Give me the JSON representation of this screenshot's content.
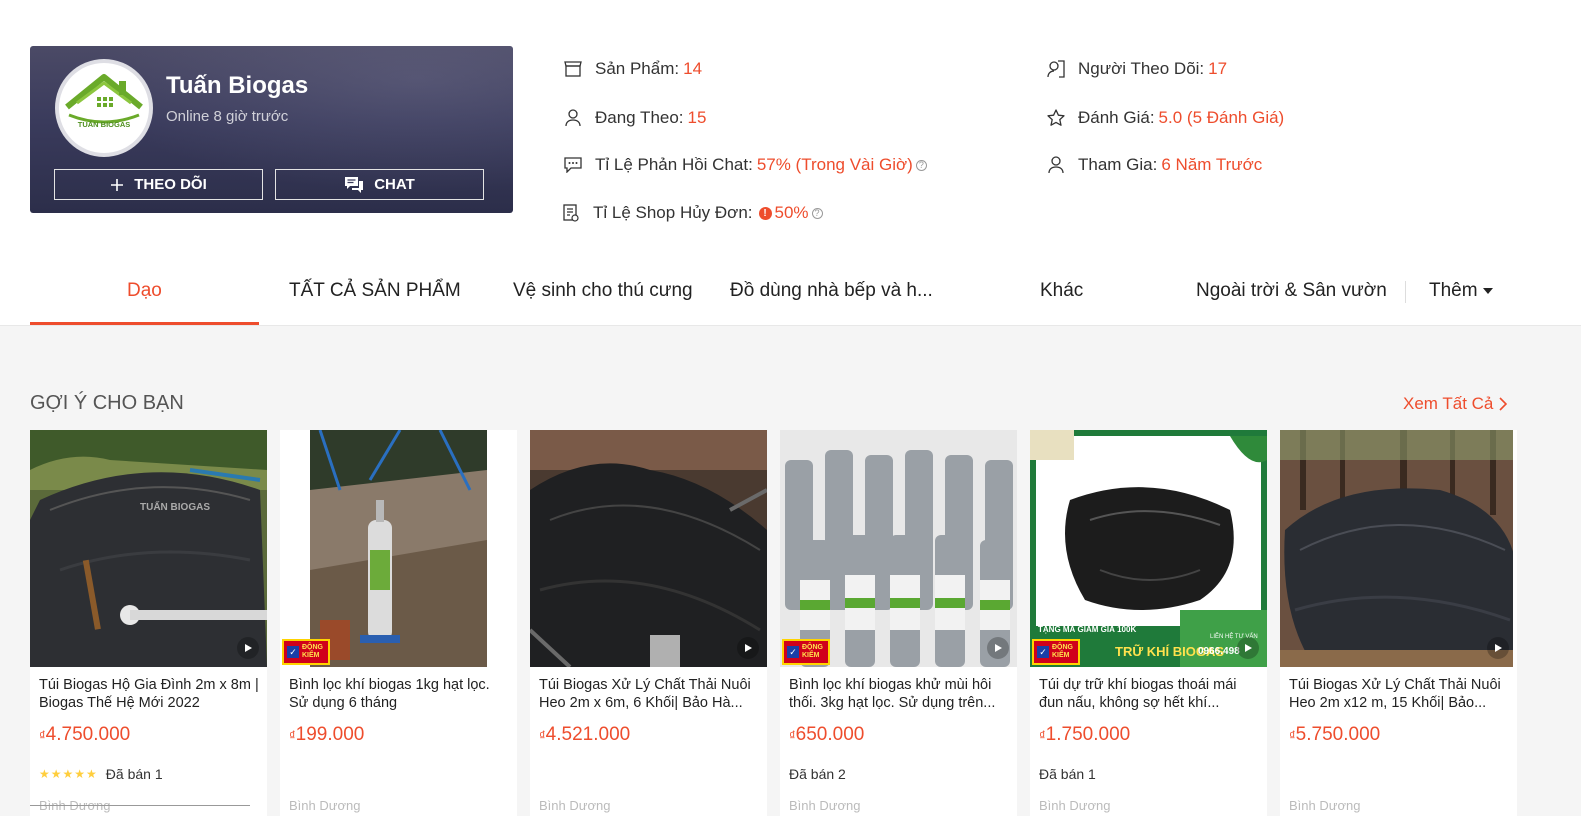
{
  "shop": {
    "name": "Tuấn Biogas",
    "online": "Online 8 giờ trước",
    "logo_text": "TUẤN BIOGAS",
    "follow_label": "THEO DÕI",
    "chat_label": "CHAT"
  },
  "stats": {
    "products_label": "Sản Phẩm:",
    "products_value": "14",
    "followers_label": "Người Theo Dõi:",
    "followers_value": "17",
    "following_label": "Đang Theo:",
    "following_value": "15",
    "rating_label": "Đánh Giá:",
    "rating_value": "5.0 (5 Đánh Giá)",
    "chat_rate_label": "Tỉ Lệ Phản Hồi Chat:",
    "chat_rate_value": "57% (Trong Vài Giờ)",
    "joined_label": "Tham Gia:",
    "joined_value": "6 Năm Trước",
    "cancel_label": "Tỉ Lệ Shop Hủy Đơn:",
    "cancel_value": "50%"
  },
  "tabs": [
    "Dạo",
    "TẤT CẢ SẢN PHẨM",
    "Vệ sinh cho thú cưng",
    "Đồ dùng nhà bếp và h...",
    "Khác",
    "Ngoài trời & Sân vườn",
    "Thêm"
  ],
  "section": {
    "title": "GỢI Ý CHO BẠN",
    "see_all": "Xem Tất Cả"
  },
  "currency": "₫",
  "products": [
    {
      "title": "Túi Biogas Hộ Gia Đình 2m x 8m | Biogas Thế Hệ Mới 2022",
      "price": "4.750.000",
      "sold": "Đã bán 1",
      "stars": "★★★★★",
      "location": "Bình Dương"
    },
    {
      "title": "Bình lọc khí biogas 1kg hạt lọc. Sử dụng 6 tháng",
      "price": "199.000",
      "sold": "",
      "stars": "",
      "location": "Bình Dương",
      "badge": "ĐỘNG KIỂM"
    },
    {
      "title": "Túi Biogas Xử Lý Chất Thải Nuôi Heo 2m x 6m, 6 Khối| Bảo Hà...",
      "price": "4.521.000",
      "sold": "",
      "stars": "",
      "location": "Bình Dương"
    },
    {
      "title": "Bình lọc khí biogas khử mùi hôi thối. 3kg hạt lọc. Sử dụng trên...",
      "price": "650.000",
      "sold": "Đã bán 2",
      "stars": "",
      "location": "Bình Dương",
      "badge": "ĐỘNG KIỂM"
    },
    {
      "title": "Túi dự trữ khí biogas thoái mái đun nấu, không sợ hết khí...",
      "price": "1.750.000",
      "sold": "Đã bán 1",
      "stars": "",
      "location": "Bình Dương",
      "badge": "ĐỘNG KIỂM",
      "banner_top": "TẶNG MÃ GIẢM GIÁ 100K",
      "banner_main": "TRỮ KHÍ BIOGAS",
      "banner_phone": "0966.498",
      "banner_contact": "LIÊN HỆ TƯ VẤN"
    },
    {
      "title": "Túi Biogas Xử Lý Chất Thải Nuôi Heo 2m x12 m, 15 Khối| Bảo...",
      "price": "5.750.000",
      "sold": "",
      "stars": "",
      "location": "Bình Dương"
    }
  ],
  "colors": {
    "accent": "#ee4d2d",
    "card_bg": "#3a3b5c"
  }
}
